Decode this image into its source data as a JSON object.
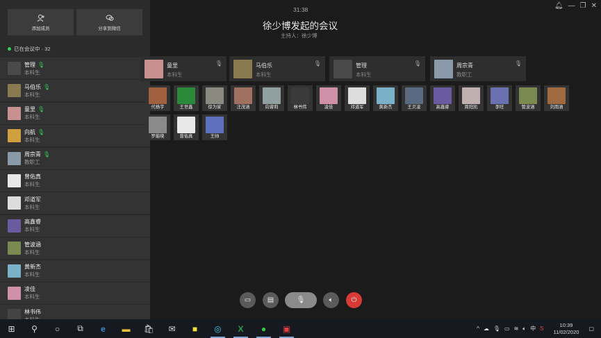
{
  "window": {
    "timer": "31:38",
    "title": "徐少博发起的会议",
    "host": "主持人：徐少博"
  },
  "sidebar": {
    "buttons": [
      {
        "label": "添加成员",
        "icon": "add-user-icon"
      },
      {
        "label": "分享到微信",
        "icon": "wechat-icon"
      }
    ],
    "status": "已在会议中 · 32",
    "participants": [
      {
        "name": "管理",
        "role": "本科生",
        "speaking": true,
        "color": "#4a4a4a"
      },
      {
        "name": "马伯乐",
        "role": "本科生",
        "speaking": true,
        "color": "#8a7a50"
      },
      {
        "name": "童里",
        "role": "本科生",
        "speaking": true,
        "color": "#c89090"
      },
      {
        "name": "向航",
        "role": "本科生",
        "speaking": true,
        "color": "#d0a040"
      },
      {
        "name": "周宗青",
        "role": "教职工",
        "speaking": true,
        "color": "#8a9aa8"
      },
      {
        "name": "曾佑真",
        "role": "本科生",
        "speaking": false,
        "color": "#e8e8e8"
      },
      {
        "name": "邓道军",
        "role": "本科生",
        "speaking": false,
        "color": "#ddd"
      },
      {
        "name": "高鑫睿",
        "role": "本科生",
        "speaking": false,
        "color": "#6a5aa0"
      },
      {
        "name": "管波涵",
        "role": "本科生",
        "speaking": false,
        "color": "#7a8a50"
      },
      {
        "name": "黄新杰",
        "role": "本科生",
        "speaking": false,
        "color": "#7ab0c8"
      },
      {
        "name": "凌佳",
        "role": "本科生",
        "speaking": false,
        "color": "#d090a8"
      },
      {
        "name": "林书伟",
        "role": "本科生",
        "speaking": false,
        "color": "#444"
      }
    ]
  },
  "main": {
    "big_tiles": [
      {
        "name": "童里",
        "role": "本科生",
        "color": "#c89090"
      },
      {
        "name": "马伯乐",
        "role": "本科生",
        "color": "#8a7a50"
      },
      {
        "name": "管理",
        "role": "本科生",
        "color": "#4a4a4a"
      },
      {
        "name": "周宗青",
        "role": "教职工",
        "color": "#8a9aa8"
      }
    ],
    "small_tiles_row1": [
      {
        "name": "代杨宇",
        "color": "#a06040"
      },
      {
        "name": "王世鑫",
        "color": "#2a8a3a"
      },
      {
        "name": "徐为家",
        "color": "#8a8a80"
      },
      {
        "name": "汪茂涵",
        "color": "#a07060"
      },
      {
        "name": "向睿莉",
        "color": "#90a0a0"
      },
      {
        "name": "林书伟",
        "color": "#3a3a3a"
      },
      {
        "name": "凌佳",
        "color": "#d090a8"
      },
      {
        "name": "邓道军",
        "color": "#ddd"
      },
      {
        "name": "黄新杰",
        "color": "#7ab0c8"
      },
      {
        "name": "王贝凌",
        "color": "#5a6a80"
      },
      {
        "name": "高鑫睿",
        "color": "#6a5aa0"
      },
      {
        "name": "周阳凯",
        "color": "#c0b0b0"
      },
      {
        "name": "李旺",
        "color": "#6a70b0"
      },
      {
        "name": "管波涵",
        "color": "#7a8a50"
      },
      {
        "name": "刘雨涵",
        "color": "#a06a40"
      }
    ],
    "small_tiles_row2": [
      {
        "name": "罗能晓",
        "color": "#8a8a8a"
      },
      {
        "name": "曾佑真",
        "color": "#e8e8e8"
      },
      {
        "name": "王帅",
        "color": "#6070c0"
      }
    ]
  },
  "taskbar": {
    "time": "10:39",
    "date": "11/02/2020",
    "lang": "中"
  }
}
